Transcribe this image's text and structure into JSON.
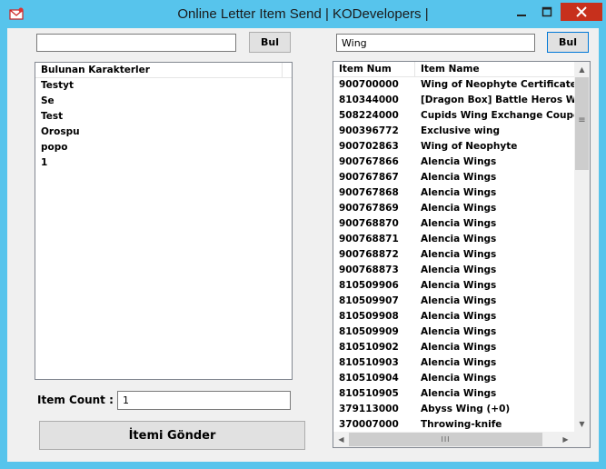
{
  "window": {
    "title": "Online Letter Item Send | KODevelopers |",
    "controls": {
      "minimize": "–",
      "maximize": "□",
      "close": "✕"
    },
    "icon": "mail-icon"
  },
  "left": {
    "search_value": "",
    "search_button": "Bul",
    "list_header": "Bulunan Karakterler",
    "characters": [
      "Testyt",
      "Se",
      "Test",
      "Orospu",
      "popo",
      "1"
    ],
    "item_count_label": "Item Count :",
    "item_count_value": "1",
    "send_button": "İtemi Gönder"
  },
  "right": {
    "search_value": "Wing",
    "search_button": "Bul",
    "columns": [
      "Item Num",
      "Item Name"
    ],
    "items": [
      {
        "num": "900700000",
        "name": "Wing of Neophyte Certificate"
      },
      {
        "num": "810344000",
        "name": "[Dragon Box] Battle Heros Wing"
      },
      {
        "num": "508224000",
        "name": "Cupids Wing Exchange Coupon"
      },
      {
        "num": "900396772",
        "name": "Exclusive wing"
      },
      {
        "num": "900702863",
        "name": "Wing of Neophyte"
      },
      {
        "num": "900767866",
        "name": "Alencia Wings"
      },
      {
        "num": "900767867",
        "name": "Alencia Wings"
      },
      {
        "num": "900767868",
        "name": "Alencia Wings"
      },
      {
        "num": "900767869",
        "name": "Alencia Wings"
      },
      {
        "num": "900768870",
        "name": "Alencia Wings"
      },
      {
        "num": "900768871",
        "name": "Alencia Wings"
      },
      {
        "num": "900768872",
        "name": "Alencia Wings"
      },
      {
        "num": "900768873",
        "name": "Alencia Wings"
      },
      {
        "num": "810509906",
        "name": "Alencia Wings"
      },
      {
        "num": "810509907",
        "name": "Alencia Wings"
      },
      {
        "num": "810509908",
        "name": "Alencia Wings"
      },
      {
        "num": "810509909",
        "name": "Alencia Wings"
      },
      {
        "num": "810510902",
        "name": "Alencia Wings"
      },
      {
        "num": "810510903",
        "name": "Alencia Wings"
      },
      {
        "num": "810510904",
        "name": "Alencia Wings"
      },
      {
        "num": "810510905",
        "name": "Alencia Wings"
      },
      {
        "num": "379113000",
        "name": "Abyss Wing (+0)"
      },
      {
        "num": "370007000",
        "name": "Throwing-knife"
      }
    ],
    "scroll_arrows": {
      "up": "▲",
      "down": "▼",
      "left": "◀",
      "right": "▶",
      "grip_v": "≡",
      "grip_h": "III"
    }
  },
  "colors": {
    "frame": "#57c4ec",
    "close": "#c7301c",
    "client": "#f0f0f0",
    "focus": "#0078d7"
  }
}
